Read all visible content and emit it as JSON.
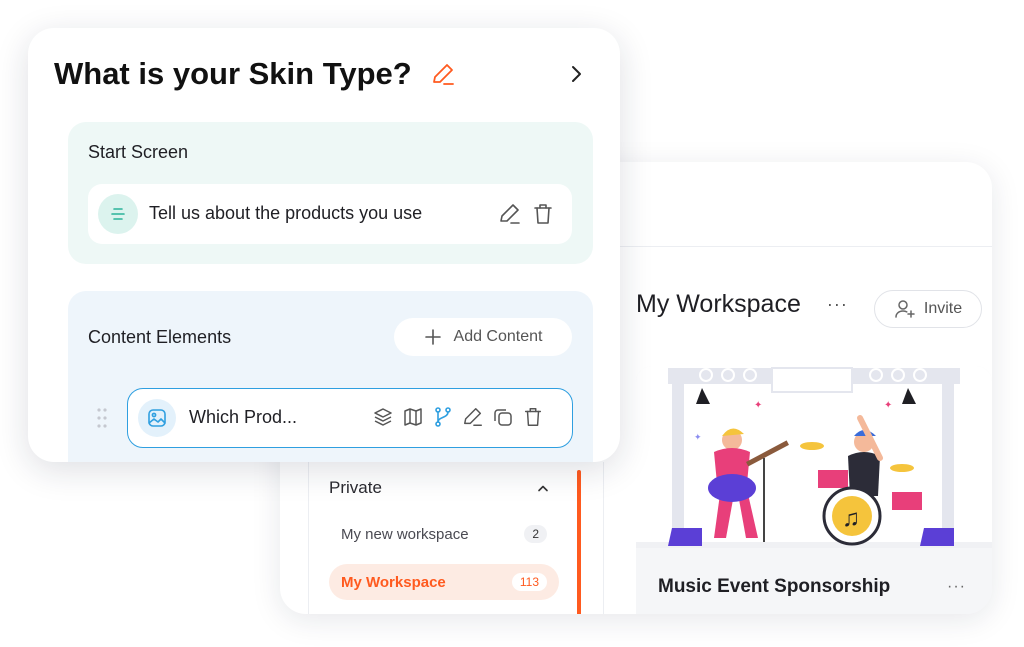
{
  "colors": {
    "accent": "#ff5a1f",
    "start_bg": "#eef8f6",
    "content_bg": "#eef5fb",
    "selected_border": "#2f9fe0"
  },
  "builder": {
    "title": "What is your Skin Type?",
    "title_edit_icon": "pencil-icon",
    "next_icon": "chevron-right-icon",
    "start_screen": {
      "label": "Start Screen",
      "item_text": "Tell us about the products you use",
      "item_icon": "text-lines-icon"
    },
    "content_elements": {
      "label": "Content Elements",
      "add_label": "Add Content",
      "item_text": "Which Prod...",
      "item_icon": "image-icon",
      "tools": [
        "layers-icon",
        "map-icon",
        "branch-icon",
        "pencil-icon",
        "duplicate-icon",
        "trash-icon"
      ]
    }
  },
  "workspace": {
    "title": "My Workspace",
    "more": "···",
    "invite_label": "Invite",
    "sidebar": {
      "section_title": "Private",
      "caret": "⌃",
      "items": [
        {
          "name": "My new workspace",
          "count": "2",
          "active": false
        },
        {
          "name": "My Workspace",
          "count": "113",
          "active": true
        }
      ]
    },
    "card": {
      "title": "Music Event Sponsorship",
      "more": "···"
    }
  }
}
